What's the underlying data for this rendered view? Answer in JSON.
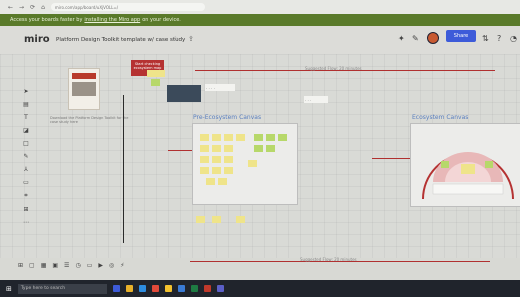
{
  "browser": {
    "url": "miro.com/app/board/uXjVOLL=/"
  },
  "banner": {
    "prefix": "Access your boards faster by",
    "link": "installing the Miro app",
    "suffix": "on your device."
  },
  "board": {
    "logo": "miro",
    "title": "Platform Design Toolkit template w/ case study",
    "share_label": "Share"
  },
  "frames": {
    "pre_ecosystem": "Pre-Ecosystem Canvas",
    "ecosystem": "Ecosystem Canvas"
  },
  "canvas_text": {
    "suggested_top": "Suggested Flow: 20 minutes",
    "suggested_bottom": "Suggested Flow: 20 minutes",
    "book_caption": "Download the Platform Design Toolkit for the case study here",
    "red_card": "Start checking ecosystem map"
  },
  "taskbar": {
    "search_placeholder": "Type here to search"
  },
  "colors": {
    "banner": "#5a7a2a",
    "accent_blue": "#3d5bd9",
    "red": "#b53232",
    "sticky_yellow": "#efe48a",
    "sticky_green": "#b7d86a"
  }
}
